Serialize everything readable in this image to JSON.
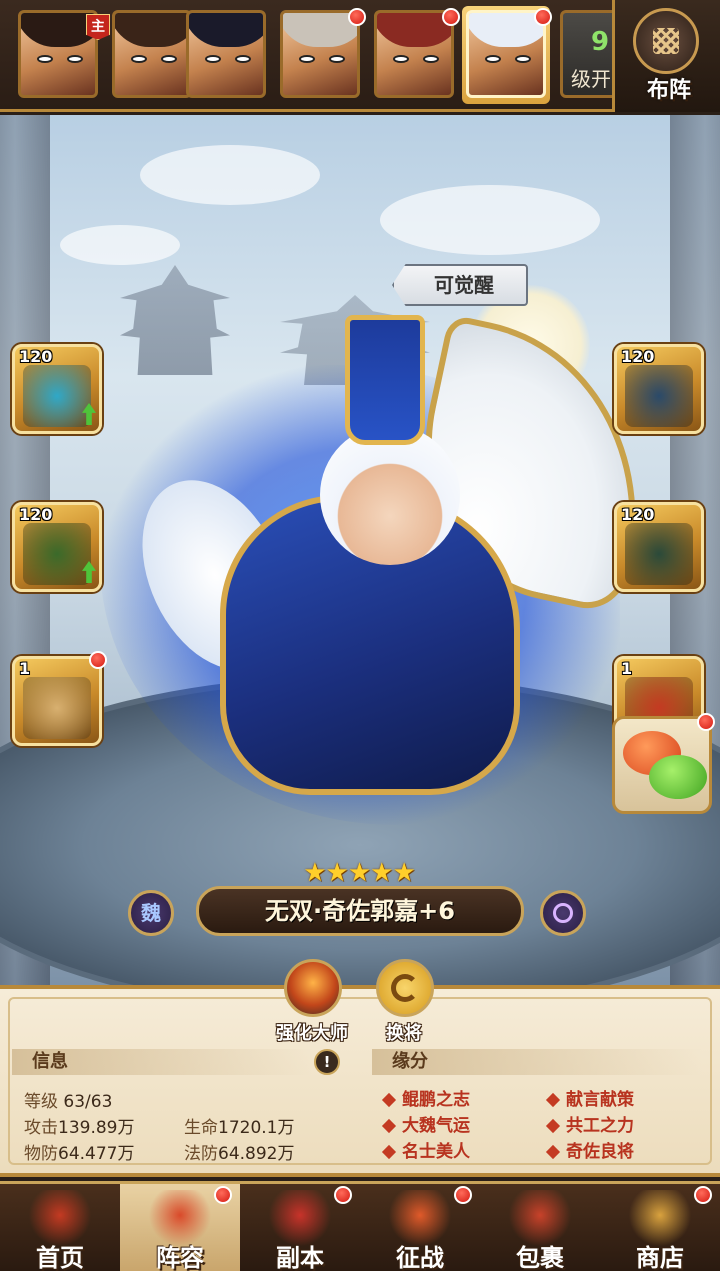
{
  "heroes": [
    {
      "name": "hero-1",
      "hair": "#2a1a14",
      "main": true,
      "dot": false,
      "active": false
    },
    {
      "name": "hero-2",
      "hair": "#3a2418",
      "main": false,
      "dot": false,
      "active": false
    },
    {
      "name": "hero-3",
      "hair": "#1a1a2a",
      "main": false,
      "dot": false,
      "active": false
    },
    {
      "name": "hero-4",
      "hair": "#c9c2b8",
      "main": false,
      "dot": true,
      "active": false
    },
    {
      "name": "hero-5",
      "hair": "#8a2a22",
      "main": false,
      "dot": true,
      "active": false
    },
    {
      "name": "hero-6",
      "hair": "#e8eef7",
      "main": false,
      "dot": true,
      "active": true
    }
  ],
  "top": {
    "main_tag": "主",
    "level_num": "9",
    "level_text": "级开",
    "formation_label": "布阵"
  },
  "awaken_label": "可觉醒",
  "equipment": {
    "left": [
      {
        "level": "120",
        "icon": "blade-icon",
        "color": "#2fa8c8",
        "up": true,
        "dot": false
      },
      {
        "level": "120",
        "icon": "crown-icon",
        "color": "#3a6a2a",
        "up": true,
        "dot": false
      },
      {
        "level": "1",
        "icon": "scroll-icon",
        "color": "#d8b070",
        "up": false,
        "dot": true
      }
    ],
    "right": [
      {
        "level": "120",
        "icon": "helmet-icon",
        "color": "#2a4a6a",
        "up": false,
        "dot": false
      },
      {
        "level": "120",
        "icon": "armor-icon",
        "color": "#2a4a3a",
        "up": false,
        "dot": false
      },
      {
        "level": "1",
        "icon": "horse-icon",
        "color": "#c43a22",
        "up": false,
        "dot": false
      }
    ]
  },
  "stars": "★★★★★",
  "faction": "魏",
  "hero_name": "无双·奇佐郭嘉+6",
  "actions": {
    "forge_label": "强化大师",
    "swap_label": "换将"
  },
  "info": {
    "title": "信息",
    "info_btn": "!",
    "level_label": "等级",
    "level_value": "63/63",
    "atk_label": "攻击",
    "atk_value": "139.89万",
    "hp_label": "生命",
    "hp_value": "1720.1万",
    "pdef_label": "物防",
    "pdef_value": "64.477万",
    "mdef_label": "法防",
    "mdef_value": "64.892万"
  },
  "bonds": {
    "title": "缘分",
    "items": [
      "鲲鹏之志",
      "献言献策",
      "大魏气运",
      "共工之力",
      "名士美人",
      "奇佐良将"
    ]
  },
  "nav": [
    {
      "label": "首页",
      "icon": "palace-icon",
      "dot": false,
      "active": false
    },
    {
      "label": "阵容",
      "icon": "flag-icon",
      "dot": true,
      "active": true
    },
    {
      "label": "副本",
      "icon": "swords-icon",
      "dot": true,
      "active": false
    },
    {
      "label": "征战",
      "icon": "target-icon",
      "dot": true,
      "active": false
    },
    {
      "label": "包裹",
      "icon": "bag-icon",
      "dot": false,
      "active": false
    },
    {
      "label": "商店",
      "icon": "coins-icon",
      "dot": true,
      "active": false
    }
  ]
}
